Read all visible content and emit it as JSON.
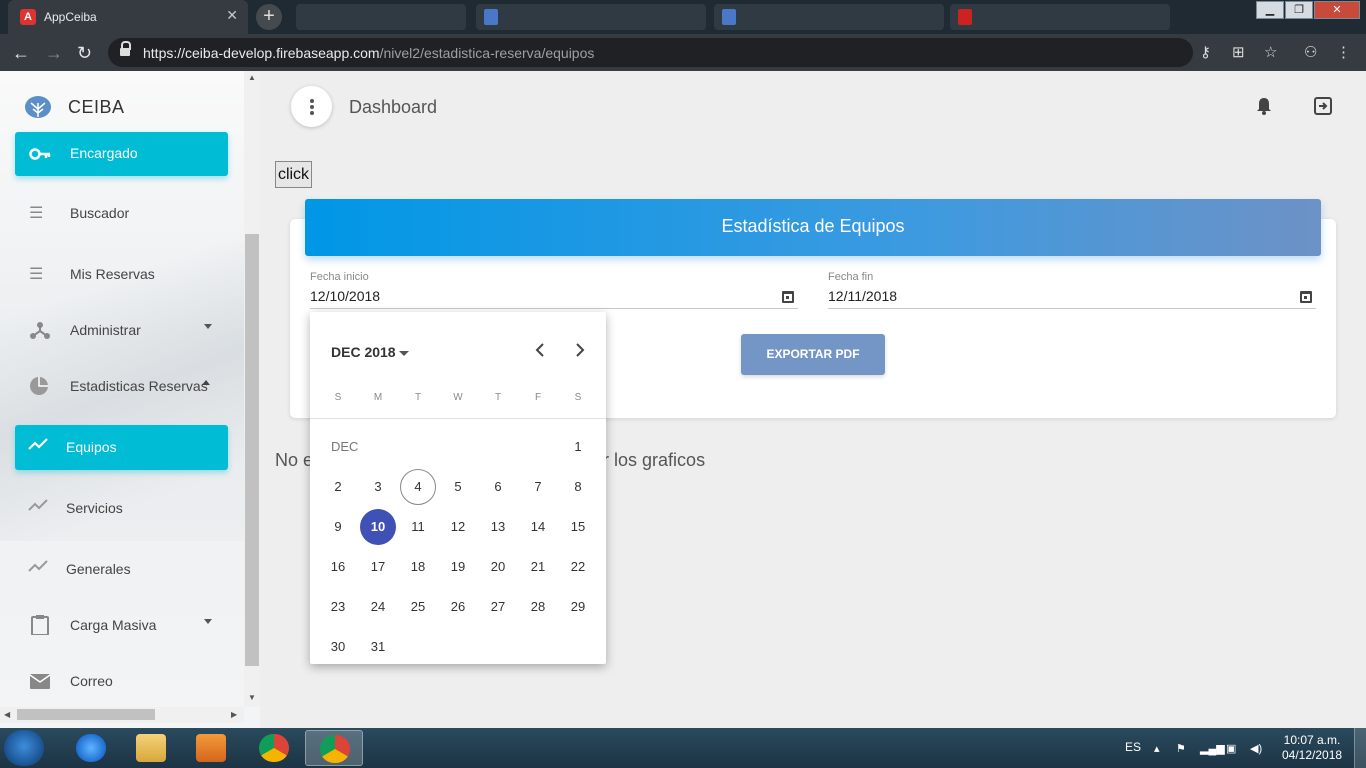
{
  "browser": {
    "active_tab_title": "AppCeiba",
    "url_host": "https://ceiba-develop.firebaseapp.com",
    "url_path": "/nivel2/estadistica-reserva/equipos"
  },
  "sidebar": {
    "brand": "CEIBA",
    "items": [
      {
        "label": "Encargado",
        "icon": "key-icon",
        "active": true
      },
      {
        "label": "Buscador",
        "icon": "list-icon"
      },
      {
        "label": "Mis Reservas",
        "icon": "list-icon"
      },
      {
        "label": "Administrar",
        "icon": "hierarchy-icon",
        "caret": "down"
      },
      {
        "label": "Estadisticas Reservas",
        "icon": "pie-chart-icon",
        "caret": "up"
      },
      {
        "label": "Equipos",
        "icon": "trending-icon",
        "active": true
      },
      {
        "label": "Servicios",
        "icon": "trending-icon"
      },
      {
        "label": "Generales",
        "icon": "trending-icon"
      },
      {
        "label": "Carga Masiva",
        "icon": "clipboard-icon",
        "caret": "down"
      },
      {
        "label": "Correo",
        "icon": "mail-icon"
      }
    ]
  },
  "header": {
    "title": "Dashboard"
  },
  "click_button": "click",
  "card": {
    "title": "Estadística de Equipos",
    "start_label": "Fecha inicio",
    "start_value": "12/10/2018",
    "end_label": "Fecha fin",
    "end_value": "12/11/2018",
    "export_button": "EXPORTAR PDF"
  },
  "notice_before": "No e",
  "notice_after": "r los graficos",
  "datepicker": {
    "month_label": "DEC 2018",
    "month_short": "DEC",
    "weekdays": [
      "S",
      "M",
      "T",
      "W",
      "T",
      "F",
      "S"
    ],
    "first_weekday": 6,
    "days_in_month": 31,
    "today": 4,
    "selected": 10
  },
  "taskbar": {
    "language": "ES",
    "time": "10:07 a.m.",
    "date": "04/12/2018"
  }
}
